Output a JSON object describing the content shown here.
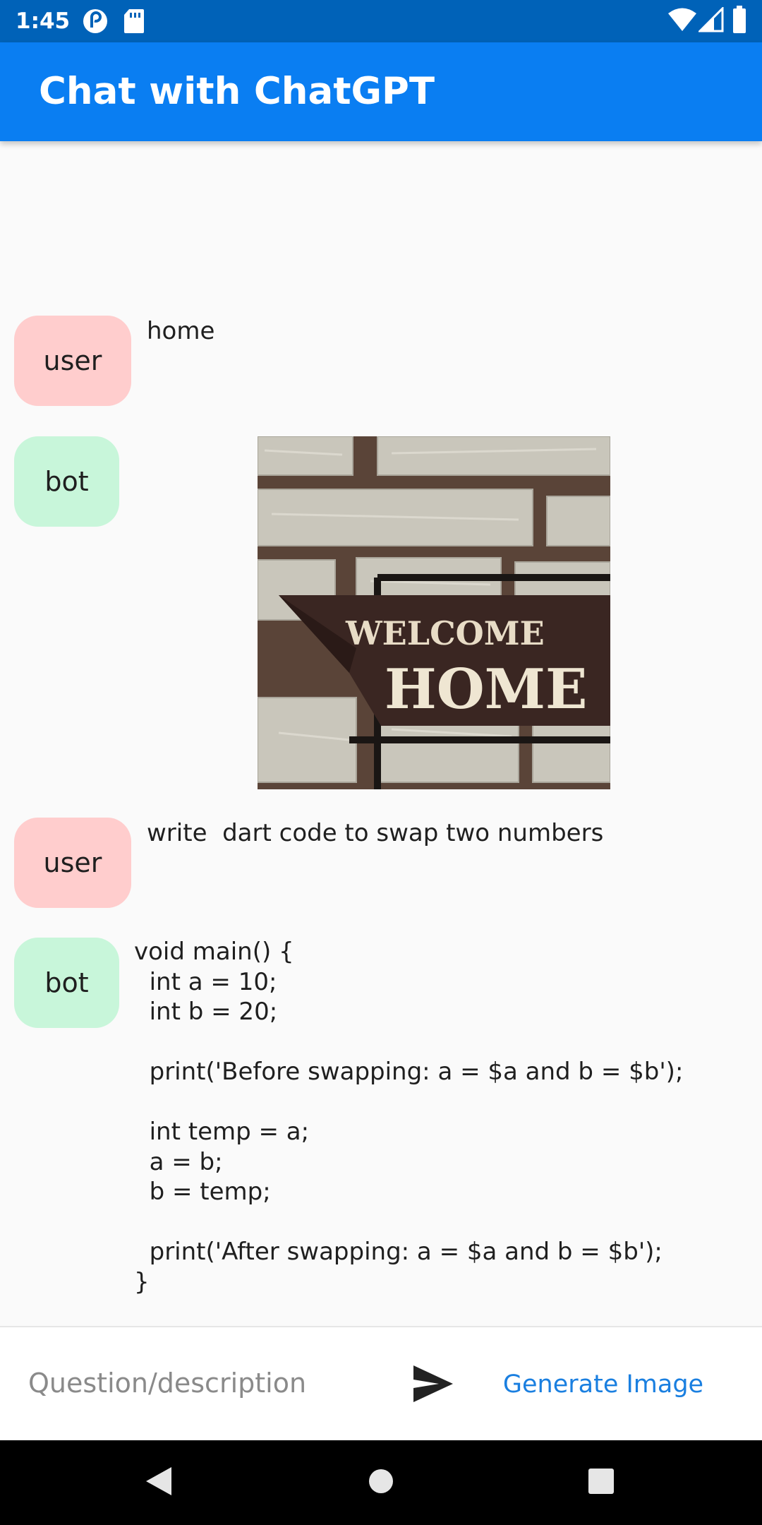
{
  "status_bar": {
    "time": "1:45",
    "icons": [
      "pocket-casts-icon",
      "sd-card-icon",
      "wifi-icon",
      "cell-signal-icon",
      "battery-icon"
    ]
  },
  "app_bar": {
    "title": "Chat with ChatGPT",
    "color": "#0a7ef2"
  },
  "messages": [
    {
      "role": "user",
      "text": "home"
    },
    {
      "role": "bot",
      "type": "image",
      "image_text": [
        "WELCOME",
        "HOME"
      ]
    },
    {
      "role": "user",
      "text": "write  dart code to swap two numbers"
    },
    {
      "role": "bot",
      "text": "void main() {\n  int a = 10;\n  int b = 20;\n\n  print('Before swapping: a = $a and b = $b');\n\n  int temp = a;\n  a = b;\n  b = temp;\n\n  print('After swapping: a = $a and b = $b');\n}"
    }
  ],
  "input": {
    "placeholder": "Question/description",
    "value": "",
    "send_icon": "send-icon",
    "generate_label": "Generate Image"
  },
  "nav_bar": {
    "icons": [
      "back-icon",
      "home-icon",
      "recents-icon"
    ]
  },
  "colors": {
    "user_badge": "#ffcdcd",
    "bot_badge": "#c8f6da",
    "accent": "#1a7fe0"
  }
}
